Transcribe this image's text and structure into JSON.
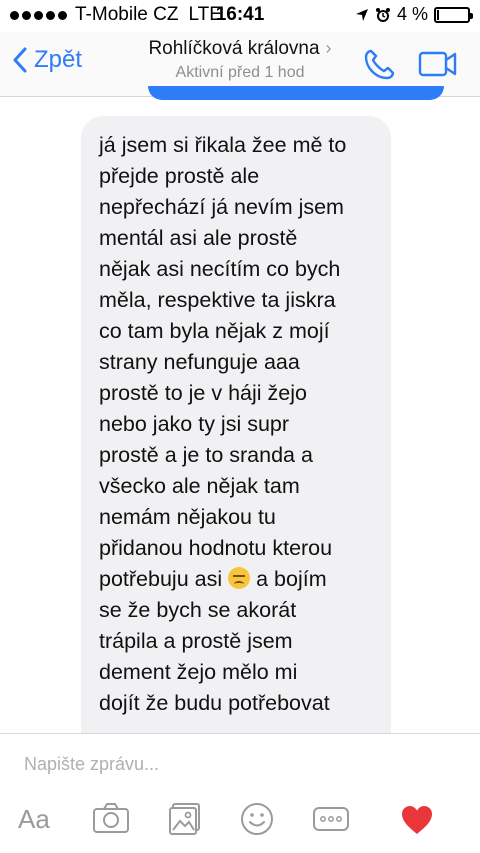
{
  "status_bar": {
    "carrier": "T-Mobile CZ",
    "network": "LTE",
    "time": "16:41",
    "battery_percent_label": "4 %",
    "battery_level": 0.04
  },
  "header": {
    "back_label": "Zpět",
    "contact_name": "Rohlíčková královna",
    "chevron": "›",
    "active_status": "Aktivní před 1 hod",
    "icons": [
      "chevron-left-icon",
      "phone-icon",
      "video-camera-icon"
    ],
    "accent_color": "#2e7cf6"
  },
  "messages": [
    {
      "direction": "incoming",
      "lines": [
        "já jsem si řikala žee mě to",
        "přejde prostě ale",
        "nepřechází já nevím jsem",
        "mentál asi ale prostě",
        "nějak asi necítím co bych",
        "měla, respektive ta jiskra",
        "co tam byla nějak z mojí",
        "strany nefunguje aaa",
        "prostě to je v háji žejo",
        "nebo jako ty jsi supr",
        "prostě a je to sranda a",
        "všecko ale nějak tam",
        "nemám nějakou tu",
        "přidanou hodnotu kterou",
        "potřebuju asi",
        "se že bych se akorát",
        "trápila a prostě jsem",
        "dement žejo mělo mi",
        "dojít že budu potřebovat"
      ],
      "emoji_line_suffix": "a bojím",
      "emoji": "disappointed-face-emoji"
    }
  ],
  "composer": {
    "placeholder": "Napište zprávu...",
    "aa_label": "Aa",
    "toolbar_icons": [
      "text-style-icon",
      "camera-icon",
      "photo-gallery-icon",
      "emoji-icon",
      "more-icon",
      "heart-icon"
    ],
    "heart_color": "#e8363b"
  }
}
